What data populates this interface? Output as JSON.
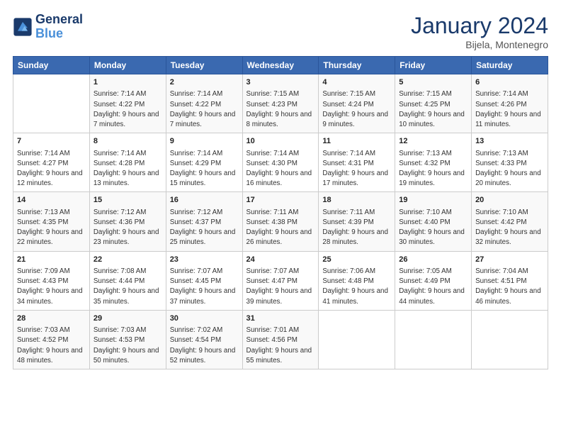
{
  "logo": {
    "line1": "General",
    "line2": "Blue"
  },
  "title": "January 2024",
  "subtitle": "Bijela, Montenegro",
  "days_of_week": [
    "Sunday",
    "Monday",
    "Tuesday",
    "Wednesday",
    "Thursday",
    "Friday",
    "Saturday"
  ],
  "weeks": [
    [
      {
        "day": "",
        "sunrise": "",
        "sunset": "",
        "daylight": ""
      },
      {
        "day": "1",
        "sunrise": "Sunrise: 7:14 AM",
        "sunset": "Sunset: 4:22 PM",
        "daylight": "Daylight: 9 hours and 7 minutes."
      },
      {
        "day": "2",
        "sunrise": "Sunrise: 7:14 AM",
        "sunset": "Sunset: 4:22 PM",
        "daylight": "Daylight: 9 hours and 7 minutes."
      },
      {
        "day": "3",
        "sunrise": "Sunrise: 7:15 AM",
        "sunset": "Sunset: 4:23 PM",
        "daylight": "Daylight: 9 hours and 8 minutes."
      },
      {
        "day": "4",
        "sunrise": "Sunrise: 7:15 AM",
        "sunset": "Sunset: 4:24 PM",
        "daylight": "Daylight: 9 hours and 9 minutes."
      },
      {
        "day": "5",
        "sunrise": "Sunrise: 7:15 AM",
        "sunset": "Sunset: 4:25 PM",
        "daylight": "Daylight: 9 hours and 10 minutes."
      },
      {
        "day": "6",
        "sunrise": "Sunrise: 7:14 AM",
        "sunset": "Sunset: 4:26 PM",
        "daylight": "Daylight: 9 hours and 11 minutes."
      }
    ],
    [
      {
        "day": "7",
        "sunrise": "Sunrise: 7:14 AM",
        "sunset": "Sunset: 4:27 PM",
        "daylight": "Daylight: 9 hours and 12 minutes."
      },
      {
        "day": "8",
        "sunrise": "Sunrise: 7:14 AM",
        "sunset": "Sunset: 4:28 PM",
        "daylight": "Daylight: 9 hours and 13 minutes."
      },
      {
        "day": "9",
        "sunrise": "Sunrise: 7:14 AM",
        "sunset": "Sunset: 4:29 PM",
        "daylight": "Daylight: 9 hours and 15 minutes."
      },
      {
        "day": "10",
        "sunrise": "Sunrise: 7:14 AM",
        "sunset": "Sunset: 4:30 PM",
        "daylight": "Daylight: 9 hours and 16 minutes."
      },
      {
        "day": "11",
        "sunrise": "Sunrise: 7:14 AM",
        "sunset": "Sunset: 4:31 PM",
        "daylight": "Daylight: 9 hours and 17 minutes."
      },
      {
        "day": "12",
        "sunrise": "Sunrise: 7:13 AM",
        "sunset": "Sunset: 4:32 PM",
        "daylight": "Daylight: 9 hours and 19 minutes."
      },
      {
        "day": "13",
        "sunrise": "Sunrise: 7:13 AM",
        "sunset": "Sunset: 4:33 PM",
        "daylight": "Daylight: 9 hours and 20 minutes."
      }
    ],
    [
      {
        "day": "14",
        "sunrise": "Sunrise: 7:13 AM",
        "sunset": "Sunset: 4:35 PM",
        "daylight": "Daylight: 9 hours and 22 minutes."
      },
      {
        "day": "15",
        "sunrise": "Sunrise: 7:12 AM",
        "sunset": "Sunset: 4:36 PM",
        "daylight": "Daylight: 9 hours and 23 minutes."
      },
      {
        "day": "16",
        "sunrise": "Sunrise: 7:12 AM",
        "sunset": "Sunset: 4:37 PM",
        "daylight": "Daylight: 9 hours and 25 minutes."
      },
      {
        "day": "17",
        "sunrise": "Sunrise: 7:11 AM",
        "sunset": "Sunset: 4:38 PM",
        "daylight": "Daylight: 9 hours and 26 minutes."
      },
      {
        "day": "18",
        "sunrise": "Sunrise: 7:11 AM",
        "sunset": "Sunset: 4:39 PM",
        "daylight": "Daylight: 9 hours and 28 minutes."
      },
      {
        "day": "19",
        "sunrise": "Sunrise: 7:10 AM",
        "sunset": "Sunset: 4:40 PM",
        "daylight": "Daylight: 9 hours and 30 minutes."
      },
      {
        "day": "20",
        "sunrise": "Sunrise: 7:10 AM",
        "sunset": "Sunset: 4:42 PM",
        "daylight": "Daylight: 9 hours and 32 minutes."
      }
    ],
    [
      {
        "day": "21",
        "sunrise": "Sunrise: 7:09 AM",
        "sunset": "Sunset: 4:43 PM",
        "daylight": "Daylight: 9 hours and 34 minutes."
      },
      {
        "day": "22",
        "sunrise": "Sunrise: 7:08 AM",
        "sunset": "Sunset: 4:44 PM",
        "daylight": "Daylight: 9 hours and 35 minutes."
      },
      {
        "day": "23",
        "sunrise": "Sunrise: 7:07 AM",
        "sunset": "Sunset: 4:45 PM",
        "daylight": "Daylight: 9 hours and 37 minutes."
      },
      {
        "day": "24",
        "sunrise": "Sunrise: 7:07 AM",
        "sunset": "Sunset: 4:47 PM",
        "daylight": "Daylight: 9 hours and 39 minutes."
      },
      {
        "day": "25",
        "sunrise": "Sunrise: 7:06 AM",
        "sunset": "Sunset: 4:48 PM",
        "daylight": "Daylight: 9 hours and 41 minutes."
      },
      {
        "day": "26",
        "sunrise": "Sunrise: 7:05 AM",
        "sunset": "Sunset: 4:49 PM",
        "daylight": "Daylight: 9 hours and 44 minutes."
      },
      {
        "day": "27",
        "sunrise": "Sunrise: 7:04 AM",
        "sunset": "Sunset: 4:51 PM",
        "daylight": "Daylight: 9 hours and 46 minutes."
      }
    ],
    [
      {
        "day": "28",
        "sunrise": "Sunrise: 7:03 AM",
        "sunset": "Sunset: 4:52 PM",
        "daylight": "Daylight: 9 hours and 48 minutes."
      },
      {
        "day": "29",
        "sunrise": "Sunrise: 7:03 AM",
        "sunset": "Sunset: 4:53 PM",
        "daylight": "Daylight: 9 hours and 50 minutes."
      },
      {
        "day": "30",
        "sunrise": "Sunrise: 7:02 AM",
        "sunset": "Sunset: 4:54 PM",
        "daylight": "Daylight: 9 hours and 52 minutes."
      },
      {
        "day": "31",
        "sunrise": "Sunrise: 7:01 AM",
        "sunset": "Sunset: 4:56 PM",
        "daylight": "Daylight: 9 hours and 55 minutes."
      },
      {
        "day": "",
        "sunrise": "",
        "sunset": "",
        "daylight": ""
      },
      {
        "day": "",
        "sunrise": "",
        "sunset": "",
        "daylight": ""
      },
      {
        "day": "",
        "sunrise": "",
        "sunset": "",
        "daylight": ""
      }
    ]
  ]
}
